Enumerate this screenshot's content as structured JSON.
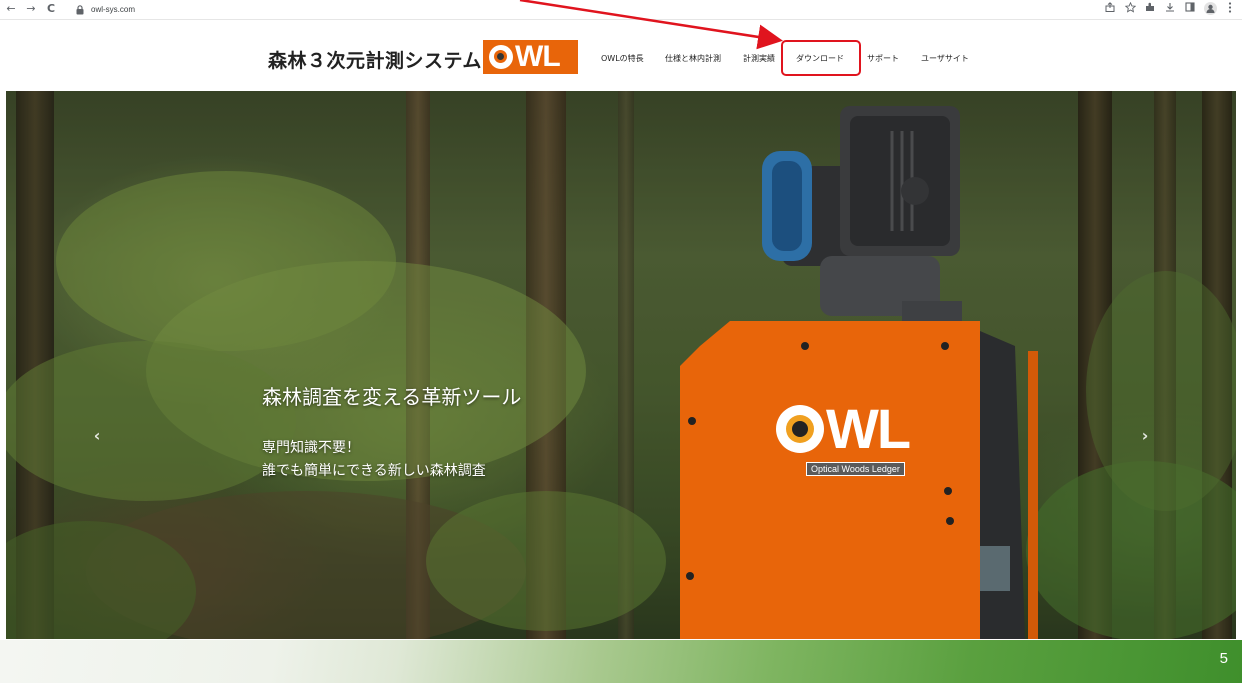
{
  "browser": {
    "url": "owl-sys.com",
    "back_icon": "←",
    "forward_icon": "→",
    "reload_icon": "C"
  },
  "site": {
    "title": "森林３次元計測システム",
    "logo_text": "WL",
    "menu": [
      "OWLの特長",
      "仕様と林内計測",
      "計測実績",
      "ダウンロード",
      "サポート",
      "ユーザサイト"
    ],
    "highlighted_menu_item": "ダウンロード",
    "accent_color": "#e8650a"
  },
  "hero": {
    "heading": "森林調査を変える革新ツール",
    "sub_line1": "専門知識不要！",
    "sub_line2": "誰でも簡単にできる新しい森林調査",
    "prev_icon": "‹",
    "next_icon": "›",
    "device_logo": "WL",
    "device_caption": "Optical Woods Ledger"
  },
  "slide": {
    "page_number": "5"
  }
}
